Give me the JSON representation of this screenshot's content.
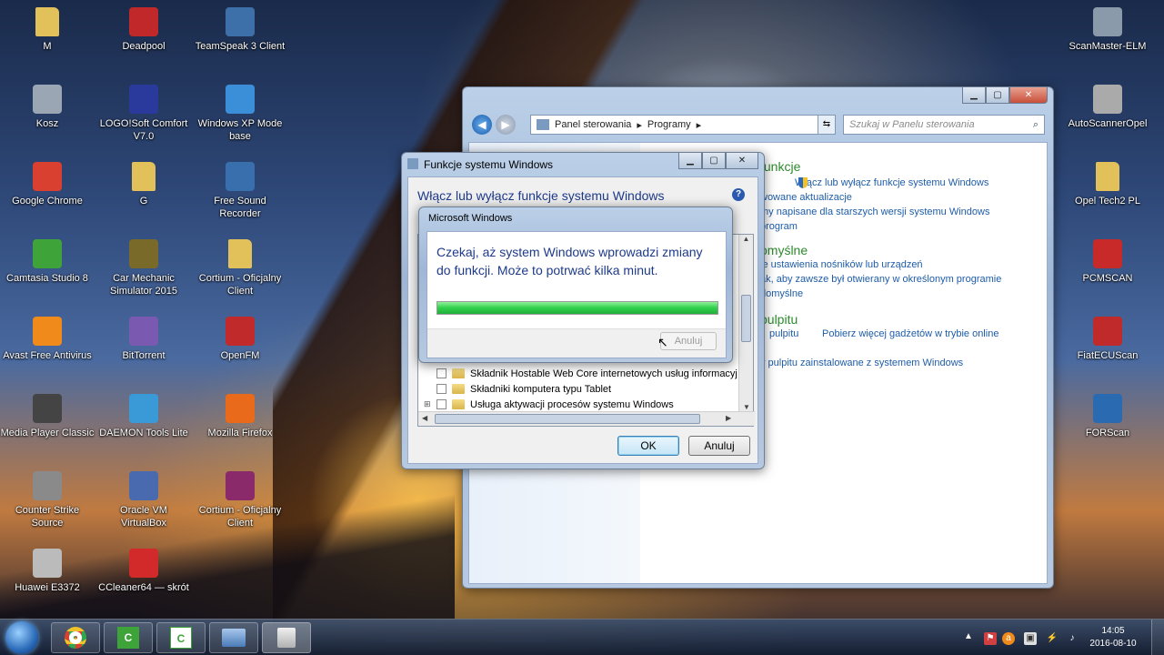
{
  "desktop": {
    "icons": [
      {
        "label": "M",
        "icon": "folder-icon",
        "color": "#e2c15a"
      },
      {
        "label": "Deadpool",
        "icon": "game-icon",
        "color": "#c0282a"
      },
      {
        "label": "TeamSpeak 3 Client",
        "icon": "teamspeak-icon",
        "color": "#3d6fa8"
      },
      {
        "label": "Kosz",
        "icon": "recycle-bin-icon",
        "color": "#9aa6b4"
      },
      {
        "label": "LOGO!Soft Comfort V7.0",
        "icon": "logosoft-icon",
        "color": "#2a3a9c"
      },
      {
        "label": "Windows XP Mode base",
        "icon": "windows-xp-mode-icon",
        "color": "#3a8fd8"
      },
      {
        "label": "Google Chrome",
        "icon": "chrome-icon",
        "color": "#d9402f"
      },
      {
        "label": "G",
        "icon": "folder-icon",
        "color": "#e2c15a"
      },
      {
        "label": "Free Sound Recorder",
        "icon": "sound-recorder-icon",
        "color": "#3a6fae"
      },
      {
        "label": "Camtasia Studio 8",
        "icon": "camtasia-icon",
        "color": "#3ea43a"
      },
      {
        "label": "Car Mechanic Simulator 2015",
        "icon": "car-mechanic-icon",
        "color": "#7a6a2a"
      },
      {
        "label": "Cortium - Oficjalny Client",
        "icon": "folder-icon",
        "color": "#e2c15a"
      },
      {
        "label": "Avast Free Antivirus",
        "icon": "avast-icon",
        "color": "#f08a1a"
      },
      {
        "label": "BitTorrent",
        "icon": "bittorrent-icon",
        "color": "#7a5ab0"
      },
      {
        "label": "OpenFM",
        "icon": "openfm-icon",
        "color": "#c02a2a"
      },
      {
        "label": "Media Player Classic",
        "icon": "media-player-icon",
        "color": "#444444"
      },
      {
        "label": "DAEMON Tools Lite",
        "icon": "daemon-tools-icon",
        "color": "#3a9ad8"
      },
      {
        "label": "Mozilla Firefox",
        "icon": "firefox-icon",
        "color": "#e86a1a"
      },
      {
        "label": "Counter Strike Source",
        "icon": "counter-strike-icon",
        "color": "#8a8a8a"
      },
      {
        "label": "Oracle VM VirtualBox",
        "icon": "virtualbox-icon",
        "color": "#4a6ab0"
      },
      {
        "label": "Cortium - Oficjalny Client",
        "icon": "winrar-icon",
        "color": "#8a2a6a"
      },
      {
        "label": "Huawei E3372",
        "icon": "huawei-icon",
        "color": "#bbbbbb"
      },
      {
        "label": "CCleaner64 — skrót",
        "icon": "ccleaner-icon",
        "color": "#d22a2a"
      },
      {
        "label": "ScanMaster-ELM",
        "icon": "scanmaster-icon",
        "color": "#8a9aaa"
      },
      {
        "label": "AutoScannerOpel",
        "icon": "opel-icon",
        "color": "#aaaaaa"
      },
      {
        "label": "Opel Tech2 PL",
        "icon": "folder-icon",
        "color": "#e2c15a"
      },
      {
        "label": "PCMSCAN",
        "icon": "pcmscan-icon",
        "color": "#c82a2a"
      },
      {
        "label": "FiatECUScan",
        "icon": "fiatecuscan-icon",
        "color": "#c02a2a"
      },
      {
        "label": "FORScan",
        "icon": "forscan-icon",
        "color": "#2a6ab0"
      }
    ]
  },
  "control_panel": {
    "nav_path": [
      "Panel sterowania",
      "Programy"
    ],
    "search_placeholder": "Szukaj w Panelu sterowania",
    "sections": [
      {
        "heading": "funkcje",
        "links": [
          "Włącz lub wyłącz funkcje systemu Windows",
          "wowane aktualizacje",
          "my napisane dla starszych wersji systemu Windows",
          "program"
        ]
      },
      {
        "heading": "omyślne",
        "links": [
          "ie ustawienia nośników lub urządzeń",
          "ak, aby zawsze był otwierany w określonym programie",
          "domyślne"
        ]
      },
      {
        "heading": "pulpitu",
        "links": [
          "pulpitu",
          "Pobierz więcej gadżetów w trybie online",
          "t",
          "y pulpitu zainstalowane z systemem Windows"
        ]
      }
    ]
  },
  "features_dialog": {
    "title": "Funkcje systemu Windows",
    "heading": "Włącz lub wyłącz funkcje systemu Windows",
    "items": [
      "Składnik Hostable Web Core internetowych usług informacyj",
      "Składniki komputera typu Tablet",
      "Usługa aktywacji procesów systemu Windows"
    ],
    "ok_label": "OK",
    "cancel_label": "Anuluj"
  },
  "progress_dialog": {
    "title": "Microsoft Windows",
    "message": "Czekaj, aż system Windows wprowadzi zmiany do funkcji. Może to potrwać kilka minut.",
    "progress": 1.0,
    "cancel_label": "Anuluj",
    "accent": "#2fd04a"
  },
  "taskbar": {
    "clock_time": "14:05",
    "clock_date": "2016-08-10",
    "apps": [
      "windows-start-icon",
      "chrome-icon",
      "camtasia-icon",
      "camtasia-recorder-icon",
      "control-panel-icon",
      "windows-features-icon"
    ]
  }
}
